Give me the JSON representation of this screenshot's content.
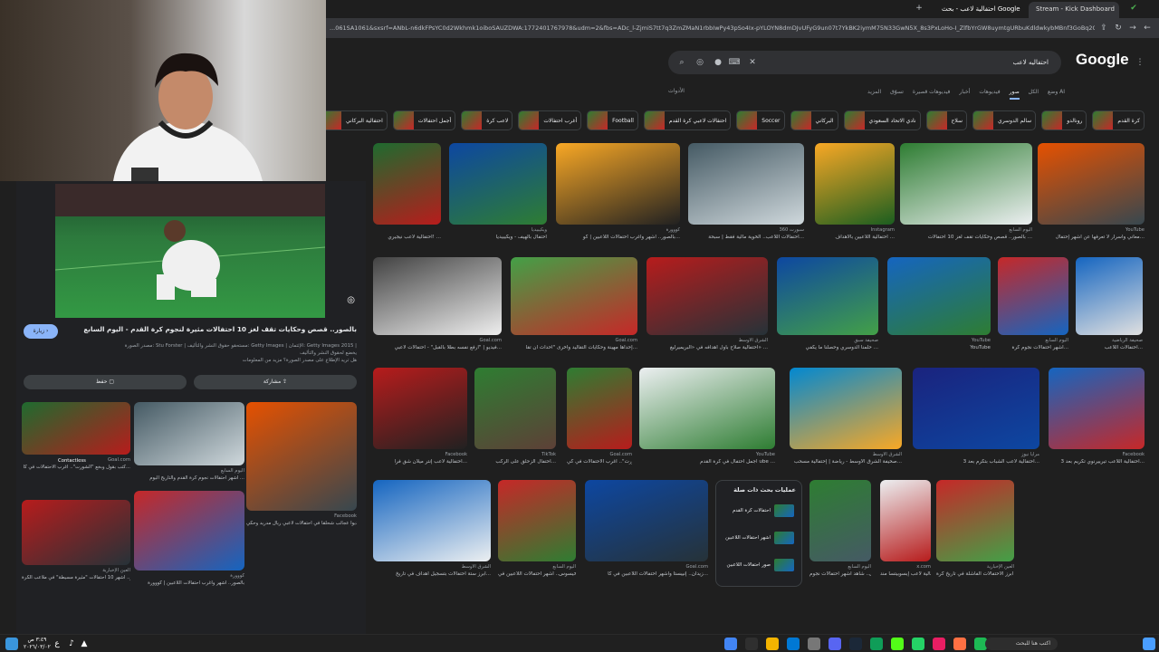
{
  "browser": {
    "tabs": [
      {
        "label": "احتفالية لاعب - بحث Google"
      },
      {
        "label": "Stream - Kick Dashboard"
      }
    ],
    "url": "...061SA1061&sxsrf=ANbL-n6dkFPsYC0d2Wkhmk1oiboSAUZDWA:1772401767978&udm=2&fbs=ADc_l-ZjmiS7tt7q3ZmZMaN1rbbIwPy43pSo4Ix-pYLOYN8dmDJvUFyG9un07t7YkBK2iymM75N33GwN5X_8s3PxLoHo-I_ZlfbYrGW8uymtgURbuKdldwkybMBnf3GoBq2C430dU..."
  },
  "google": {
    "logo": "Google",
    "query": "احتفاليه لاعب",
    "tabs": [
      "وضع AI",
      "الكل",
      "صور",
      "فيديوهات",
      "أخبار",
      "فيديوهات قصيرة",
      "تسوّق",
      "المزيد"
    ],
    "tools": "الأدوات",
    "chips": [
      "كرة القدم",
      "رونالدو",
      "سالم الدوسري",
      "سلاح",
      "نادي الاتحاد السعودي",
      "البركاني",
      "Soccer",
      "احتفالات لاعبي كرة القدم",
      "Football",
      "أغرب احتفالات",
      "لاعب كرة",
      "أجمل احتفالات",
      "احتفالية البركاني"
    ],
    "results": [
      {
        "source": "",
        "caption": "احتفالية لاعب نيجيري! ..."
      },
      {
        "source": "ويكيبيديا",
        "caption": "احتفال بالهيف - ويكيبيديا"
      },
      {
        "source": "كووورة",
        "caption": "بالصور.. أشهر وأغرب احتفالات اللاعبين | كو..."
      },
      {
        "source": "سبورت 360",
        "caption": "احتفالات اللاعب.. الخوية مالية فقط | سبحة..."
      },
      {
        "source": "Instagram",
        "caption": "احتفالية اللاعبين بالأهداف ..."
      },
      {
        "source": "اليوم السابع",
        "caption": "بالصور.. قصص وحكايات تقف لغز 10 احتفالات ..."
      },
      {
        "source": "YouTube",
        "caption": "معاني وأسرار لا تعرفها عن أشهر إحتفال..."
      },
      {
        "source": "Goal.com",
        "caption": "فيديو | \"أرفع نفسه بطلاً بالقبل\" - احتفالات لاعبي..."
      },
      {
        "source": "Goal.com",
        "caption": "إحداها مهينة وحكايات التقاليد وأخرى \"أحداث أن تقا..."
      },
      {
        "source": "الشرق الأوسط",
        "caption": "احتفالية صلاح بأول أهدافه في «البريميرليغ» ..."
      },
      {
        "source": "صحيفة سبق",
        "caption": "حلمنا الدوسري وحصلنا ما يكفي ..."
      },
      {
        "source": "YouTube",
        "caption": "YouTube"
      },
      {
        "source": "اليوم السابع",
        "caption": "أشهر احتفالات نجوم كرة..."
      },
      {
        "source": "صحيفة الرياضية",
        "caption": "احتفالات اللاعب..."
      },
      {
        "source": "Facebook",
        "caption": "احتفالية لاعب إنتر ميلان شق فرا..."
      },
      {
        "source": "TikTok",
        "caption": "احتفال الزحلق على الركب..."
      },
      {
        "source": "Goal.com",
        "caption": "كانت بالوي وعانق \"الشورت\".. أغرب الاحتفالات في كي..."
      },
      {
        "source": "YouTube",
        "caption": "أجمل احتفال في كرة القدم ube ..."
      },
      {
        "source": "الشرق الأوسط",
        "caption": "صحيفة الشرق الأوسط - رياضة | إحتفالية مسحب..."
      },
      {
        "source": "مرايا نيوز",
        "caption": "احتفالية لاعب الشباب بتكرم بعد 3..."
      },
      {
        "source": "Facebook",
        "caption": "احتفالية اللاعب تيرييرنوي تكريم بعد 3..."
      },
      {
        "source": "الشرق الأوسط",
        "caption": "أبرز ستة احتفالات بتسجيل أهداف في تاريخ..."
      },
      {
        "source": "اليوم السابع",
        "caption": "اخرهم خيسوس.. أشهر احتفالات اللاعبين في ..."
      },
      {
        "source": "Goal.com",
        "caption": "زيدان.. إنييستا وأشهر احتفالات اللاعبين في كأ..."
      },
      {
        "source": "اليوم السابع",
        "caption": "آخرهم خيسوس.. شاهد أشهر احتفالات نجوم ..."
      },
      {
        "source": "x.com",
        "caption": "احتفالية لاعب إبسوبيتسا مند..."
      },
      {
        "source": "العين الإخبارية",
        "caption": "بالفيديو.. أبرز الاحتفالات الفاشلة في تاريخ كرة..."
      }
    ],
    "related": {
      "title": "عمليات بحث ذات صلة",
      "items": [
        "احتفالات كرة القدم",
        "اشهر احتفالات اللاعبين",
        "صور احتفالات اللاعبين"
      ]
    }
  },
  "preview": {
    "title": "بالصور.. قصص وحكايات تقف لغز 10 احتفالات مثيرة لنجوم كرة القدم - اليوم السابع",
    "visit": "زيارة",
    "meta": "مصدر الصورة: Stu Forster | مستحقو حقوق النشر والتأليف: Getty Images | الإئتمان: Getty Images 2015 | يخضع لحقوق النشر والتأليف",
    "meta2": "هل تريد الإطلاع على مصدر الصورة؟ مزيد من المعلومات",
    "share": "مشاركة",
    "save": "حفظ",
    "thumbs": [
      {
        "source": "Goal.com",
        "caption": "كتب بقول وبخع \"الشورت\".. أغرب الاحتفالات في كأ..."
      },
      {
        "source": "اليوم السابع",
        "caption": "أشهر احتفالات نجوم كرة القدم والتاريخ اليوم ..."
      },
      {
        "source": "Facebook",
        "caption": "فيديوا عجائب شحلقا في احتفالات لاعبي ريال مدريد وحكي..."
      },
      {
        "source": "العين الإخبارية",
        "caption": "فيديو.. أشهر 10 احتفالات \"مثيرة مسيطة\" في ملاعب الكرة"
      },
      {
        "source": "كووورة",
        "caption": "بالصور.. أشهر وأغرب احتفالات اللاعبين | كووورة"
      }
    ],
    "overlay_text": "Contactless"
  },
  "taskbar": {
    "time": "٣:٤٩ ص",
    "date": "٢٠٢٦/٠٣/٠٢",
    "lang": "ع",
    "search": "اكتب هنا للبحث"
  },
  "colors": {
    "accent": "#8ab4f8",
    "bg": "#1f1f1f"
  }
}
